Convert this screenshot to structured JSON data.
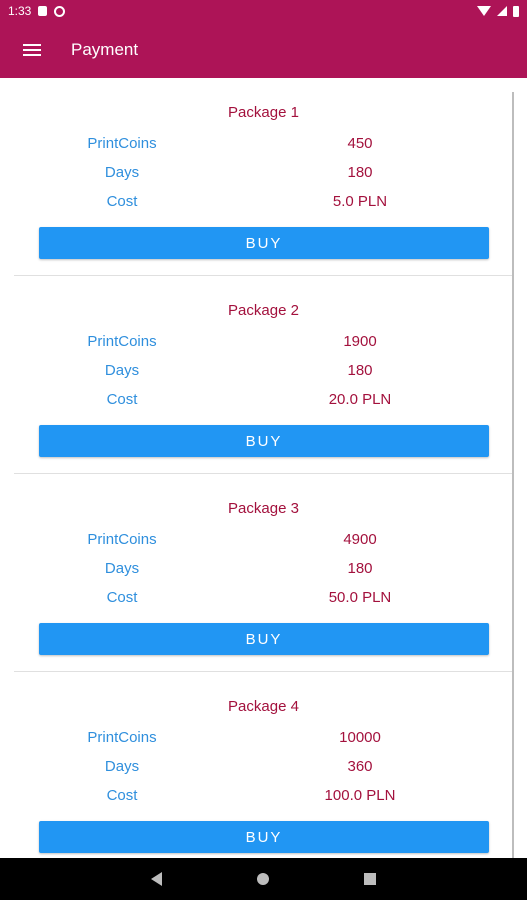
{
  "status_bar": {
    "time": "1:33",
    "icons": [
      "notification-icon",
      "vpn-icon",
      "wifi-icon",
      "signal-icon",
      "battery-icon"
    ]
  },
  "app_bar": {
    "title": "Payment",
    "menu_icon": "hamburger-menu-icon",
    "background_color": "#ad1457"
  },
  "labels": {
    "printcoins": "PrintCoins",
    "days": "Days",
    "cost": "Cost",
    "buy": "BUY"
  },
  "packages": [
    {
      "title": "Package 1",
      "printcoins": "450",
      "days": "180",
      "cost": "5.0 PLN"
    },
    {
      "title": "Package 2",
      "printcoins": "1900",
      "days": "180",
      "cost": "20.0 PLN"
    },
    {
      "title": "Package 3",
      "printcoins": "4900",
      "days": "180",
      "cost": "50.0 PLN"
    },
    {
      "title": "Package 4",
      "printcoins": "10000",
      "days": "360",
      "cost": "100.0 PLN"
    }
  ],
  "colors": {
    "accent": "#ad1457",
    "value_text": "#a3113d",
    "label_text": "#2f8fdd",
    "button": "#2196f3"
  },
  "nav_bar": {
    "icons": [
      "back-icon",
      "home-icon",
      "recents-icon"
    ]
  }
}
